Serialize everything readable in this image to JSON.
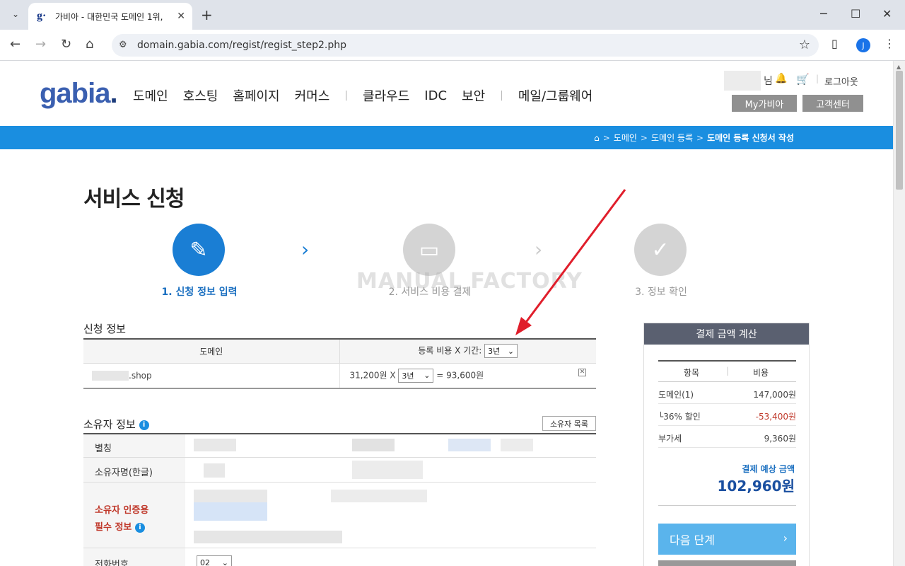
{
  "browser": {
    "tab_title": "가비아 - 대한민국 도메인 1위,",
    "tab_favicon": "g·",
    "new_tab": "+",
    "url": "domain.gabia.com/regist/regist_step2.php",
    "avatar_letter": "J",
    "window_controls": [
      "─",
      "☐",
      "✕"
    ]
  },
  "header": {
    "logo": "gabia",
    "logo_dot": ".",
    "gnb": [
      "도메인",
      "호스팅",
      "홈페이지",
      "커머스",
      "클라우드",
      "IDC",
      "보안",
      "메일/그룹웨어"
    ],
    "util_nim": "님",
    "logout": "로그아웃",
    "my_gabia": "My가비아",
    "customer_center": "고객센터",
    "breadcrumb": [
      "도메인",
      "도메인 등록",
      "도메인 등록 신청서 작성"
    ]
  },
  "page": {
    "title": "서비스 신청",
    "steps": [
      "1. 신청 정보 입력",
      "2. 서비스 비용 결제",
      "3. 정보 확인"
    ],
    "watermark": "MANUAL FACTORY"
  },
  "application": {
    "section_title": "신청 정보",
    "col_domain": "도메인",
    "col_fee": "등록 비용 X 기간:",
    "period_header_value": "3년",
    "domain_suffix": ".shop",
    "unit_price": "31,200원",
    "times": "X",
    "period_value": "3년",
    "equals_total": "= 93,600원",
    "remove": "✕"
  },
  "owner": {
    "section_title": "소유자 정보",
    "list_button": "소유자 목록",
    "rows": [
      "별칭",
      "소유자명(한글)",
      "소유자 인증용",
      "필수 정보",
      "전화번호"
    ],
    "phone_prefix": "02"
  },
  "calc": {
    "title": "결제 금액 계산",
    "col_item": "항목",
    "col_cost": "비용",
    "items": [
      {
        "label": "도메인(1)",
        "value": "147,000원"
      },
      {
        "label": "└36% 할인",
        "value": "-53,400원"
      },
      {
        "label": "부가세",
        "value": "9,360원"
      }
    ],
    "total_label": "결제 예상 금액",
    "total_value": "102,960원",
    "next_button": "다음 단계",
    "discount_color": "#c0392b"
  }
}
